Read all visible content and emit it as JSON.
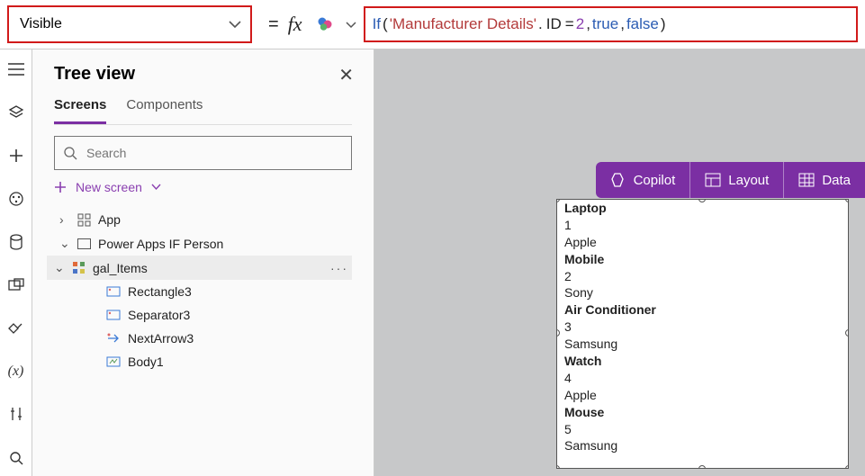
{
  "formula": {
    "property": "Visible",
    "eq": "=",
    "fx": "fx",
    "tokens": {
      "fn": "If",
      "open": "(",
      "str": "'Manufacturer Details'",
      "dot1": ".",
      "field": "ID",
      "opeq": "=",
      "num": "2",
      "c1": ",",
      "t": "true",
      "c2": ",",
      "f": "false",
      "close": ")"
    }
  },
  "tree": {
    "title": "Tree view",
    "tabs": {
      "screens": "Screens",
      "components": "Components"
    },
    "search_placeholder": "Search",
    "new_screen": "New screen",
    "nodes": {
      "app": "App",
      "screen": "Power Apps IF Person",
      "gallery": "gal_Items",
      "children": [
        "Rectangle3",
        "Separator3",
        "NextArrow3",
        "Body1"
      ]
    }
  },
  "canvas": {
    "toolbar": {
      "copilot": "Copilot",
      "layout": "Layout",
      "data": "Data"
    },
    "gallery_items": [
      {
        "title": "Laptop",
        "id": "1",
        "brand": "Apple"
      },
      {
        "title": "Mobile",
        "id": "2",
        "brand": "Sony"
      },
      {
        "title": "Air Conditioner",
        "id": "3",
        "brand": "Samsung"
      },
      {
        "title": "Watch",
        "id": "4",
        "brand": "Apple"
      },
      {
        "title": "Mouse",
        "id": "5",
        "brand": "Samsung"
      }
    ]
  }
}
